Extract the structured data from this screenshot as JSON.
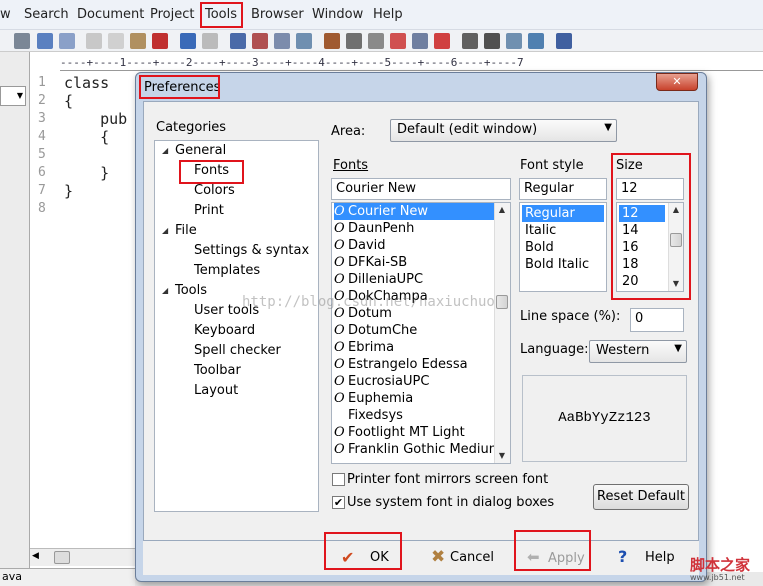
{
  "menubar": {
    "items": [
      "w",
      "Search",
      "Document",
      "Project",
      "Tools",
      "Browser",
      "Window",
      "Help"
    ]
  },
  "ruler": {
    "text": "----+----1----+----2----+----3----+----4----+----5----+----6----+----7"
  },
  "editor": {
    "line_numbers": [
      "1",
      "2",
      "3",
      "4",
      "5",
      "6",
      "7",
      "8"
    ],
    "lines": [
      "class",
      "{",
      "    pub",
      "    {",
      "",
      "    }",
      "}",
      ""
    ]
  },
  "status": {
    "text": "ava"
  },
  "watermark": "http://blog.csdn.net/naxiuchuo",
  "dialog": {
    "title": "Preferences",
    "close_glyph": "✕",
    "categories_label": "Categories",
    "tree": [
      {
        "label": "General",
        "level": 0,
        "expanded": true
      },
      {
        "label": "Fonts",
        "level": 1,
        "selected": true
      },
      {
        "label": "Colors",
        "level": 1
      },
      {
        "label": "Print",
        "level": 1
      },
      {
        "label": "File",
        "level": 0,
        "expanded": true
      },
      {
        "label": "Settings & syntax",
        "level": 1
      },
      {
        "label": "Templates",
        "level": 1
      },
      {
        "label": "Tools",
        "level": 0,
        "expanded": true
      },
      {
        "label": "User tools",
        "level": 1
      },
      {
        "label": "Keyboard",
        "level": 1
      },
      {
        "label": "Spell checker",
        "level": 1
      },
      {
        "label": "Toolbar",
        "level": 1
      },
      {
        "label": "Layout",
        "level": 1
      }
    ],
    "area_label": "Area:",
    "area_value": "Default (edit window)",
    "fonts_label": "Fonts",
    "font_value": "Courier New",
    "font_list": [
      "Courier New",
      "DaunPenh",
      "David",
      "DFKai-SB",
      "DilleniaUPC",
      "DokChampa",
      "Dotum",
      "DotumChe",
      "Ebrima",
      "Estrangelo Edessa",
      "EucrosiaUPC",
      "Euphemia",
      "Fixedsys",
      "Footlight MT Light",
      "Franklin Gothic Medium"
    ],
    "font_style_label": "Font style",
    "style_value": "Regular",
    "style_list": [
      "Regular",
      "Italic",
      "Bold",
      "Bold Italic"
    ],
    "size_label": "Size",
    "size_value": "12",
    "size_list": [
      "12",
      "14",
      "16",
      "18",
      "20"
    ],
    "line_space_label": "Line space (%):",
    "line_space_value": "0",
    "language_label": "Language:",
    "language_value": "Western",
    "preview_text": "AaBbYyZz123",
    "printer_mirror_label": "Printer font mirrors screen font",
    "printer_mirror_checked": false,
    "system_font_label": "Use system font in dialog boxes",
    "system_font_checked": true,
    "reset_label": "Reset Default",
    "ok_label": "OK",
    "cancel_label": "Cancel",
    "apply_label": "Apply",
    "help_label": "Help"
  },
  "site_watermark": {
    "name": "脚本之家",
    "url": "www.jb51.net"
  },
  "colors": {
    "highlight": "#e0141c",
    "selection": "#3390ff"
  }
}
